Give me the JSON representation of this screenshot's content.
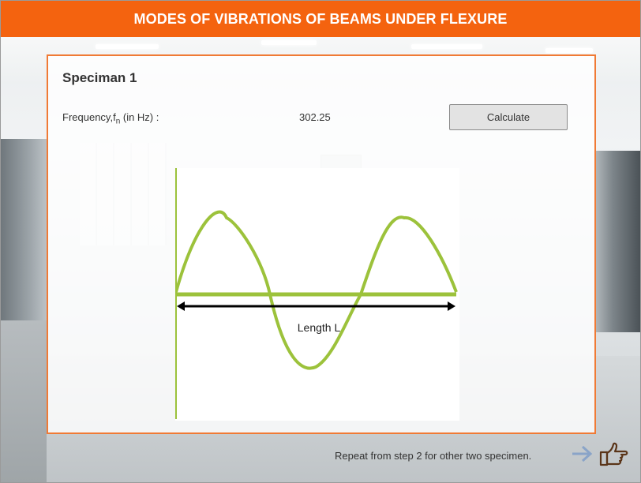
{
  "header": {
    "title": "MODES OF VIBRATIONS OF BEAMS UNDER FLEXURE"
  },
  "panel": {
    "specimen_title": "Speciman 1",
    "frequency": {
      "label_prefix": "Frequency,f",
      "label_subscript": "n",
      "label_suffix": " (in Hz) :",
      "value": "302.25"
    },
    "calculate_label": "Calculate",
    "diagram": {
      "caption": "Length L",
      "wave_color": "#9cc23b",
      "arrow_color": "#000000"
    }
  },
  "footer": {
    "note": "Repeat from step 2 for other two specimen.",
    "next_arrow_icon": "arrow-right-icon",
    "hand_icon": "pointing-hand-icon"
  },
  "colors": {
    "accent": "#f4630f",
    "panel_border": "#f07a35"
  }
}
